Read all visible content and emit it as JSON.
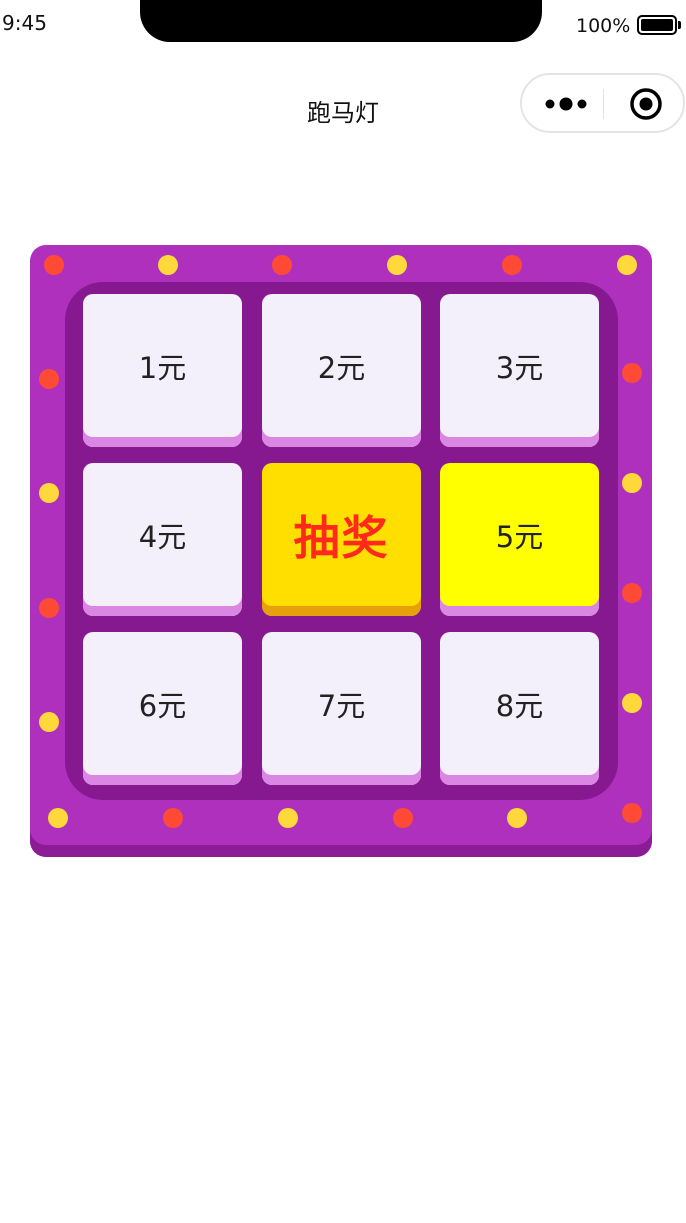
{
  "status_bar": {
    "time": "9:45",
    "battery_level": "100%"
  },
  "nav": {
    "title": "跑马灯",
    "more_icon": "more-dots-icon",
    "close_icon": "target-close-icon"
  },
  "colors": {
    "board": "#b030be",
    "board_inner": "#86198f",
    "cell": "#f3f0fc",
    "cell_active": "#ffff00",
    "draw_button": "#ffdf00",
    "draw_text": "#ff2a1b",
    "light_yellow": "#ffd83b",
    "light_red": "#ff4b36"
  },
  "lottery": {
    "draw_label": "抽奖",
    "active_prize_index": 4,
    "prizes": [
      "1元",
      "2元",
      "3元",
      "4元",
      "5元",
      "6元",
      "7元",
      "8元"
    ]
  }
}
